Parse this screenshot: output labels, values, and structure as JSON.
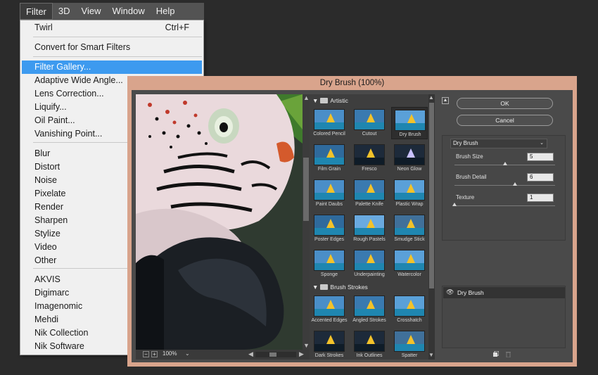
{
  "menubar": {
    "items": [
      "Filter",
      "3D",
      "View",
      "Window",
      "Help"
    ]
  },
  "menu": {
    "last_filter": "Twirl",
    "last_filter_shortcut": "Ctrl+F",
    "convert_smart": "Convert for Smart Filters",
    "items_a": [
      "Filter Gallery...",
      "Adaptive Wide Angle...",
      "Lens Correction...",
      "Liquify...",
      "Oil Paint...",
      "Vanishing Point..."
    ],
    "items_b": [
      "Blur",
      "Distort",
      "Noise",
      "Pixelate",
      "Render",
      "Sharpen",
      "Stylize",
      "Video",
      "Other"
    ],
    "items_c": [
      "AKVIS",
      "Digimarc",
      "Imagenomic",
      "Mehdi",
      "Nik Collection",
      "Nik Software"
    ]
  },
  "dialog": {
    "title": "Dry Brush (100%)",
    "zoom": "100%",
    "ok": "OK",
    "cancel": "Cancel",
    "filter_select": "Dry Brush",
    "params": [
      {
        "label": "Brush Size",
        "value": "5",
        "fraction": 0.5
      },
      {
        "label": "Brush Detail",
        "value": "6",
        "fraction": 0.6
      },
      {
        "label": "Texture",
        "value": "1",
        "fraction": 0.0
      }
    ],
    "layer_name": "Dry Brush"
  },
  "gallery": {
    "folder_artistic": "Artistic",
    "folder_brush": "Brush Strokes",
    "artistic": [
      "Colored Pencil",
      "Cutout",
      "Dry Brush",
      "Film Grain",
      "Fresco",
      "Neon Glow",
      "Paint Daubs",
      "Palette Knife",
      "Plastic Wrap",
      "Poster Edges",
      "Rough Pastels",
      "Smudge Stick",
      "Sponge",
      "Underpainting",
      "Watercolor"
    ],
    "brush": [
      "Accented Edges",
      "Angled Strokes",
      "Crosshatch",
      "Dark Strokes",
      "Ink Outlines",
      "Spatter"
    ],
    "selected": "Dry Brush"
  },
  "colors": {
    "dialog_border": "#d9a48c",
    "menu_highlight": "#3d9aef"
  }
}
